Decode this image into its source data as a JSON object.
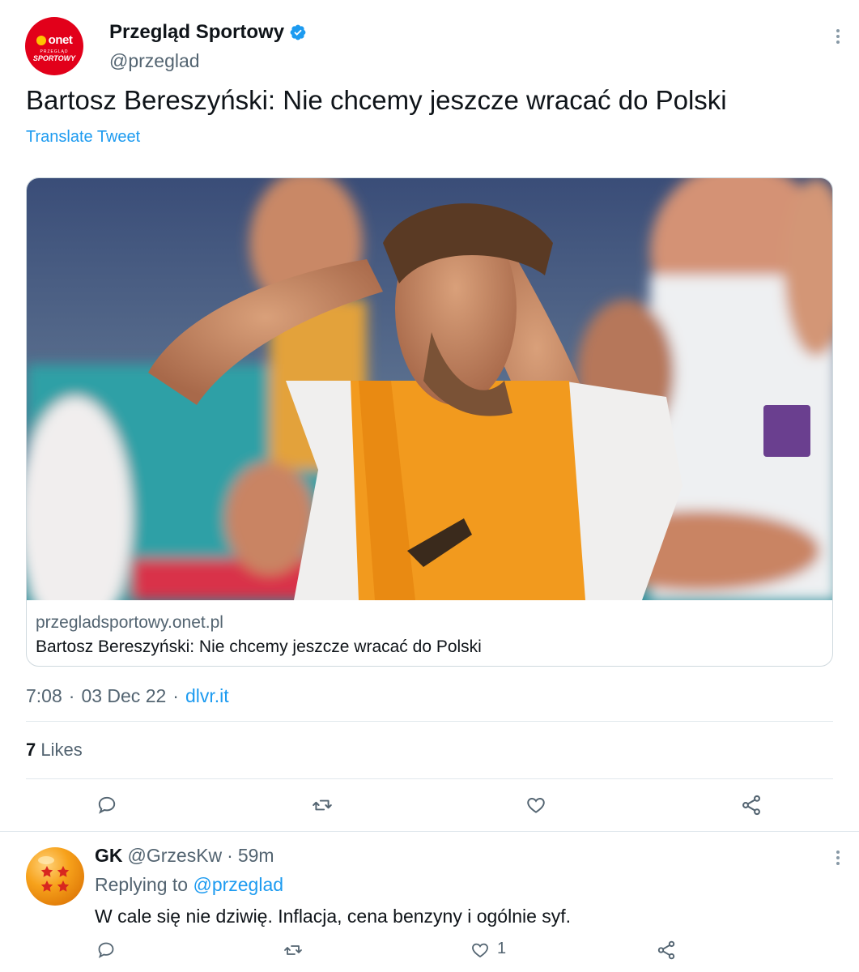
{
  "tweet": {
    "author": {
      "name": "Przegląd Sportowy",
      "handle": "@przeglad",
      "avatar_text": "onet",
      "avatar_sub1": "PRZEGLĄD",
      "avatar_sub2": "SPORTOWY",
      "verified": true
    },
    "text": "Bartosz Bereszyński: Nie chcemy jeszcze wracać do Polski",
    "translate_label": "Translate Tweet",
    "card": {
      "domain": "przegladsportowy.onet.pl",
      "title": "Bartosz Bereszyński: Nie chcemy jeszcze wracać do Polski"
    },
    "time": "7:08",
    "date": "03 Dec 22",
    "via": "dlvr.it",
    "likes_count": "7",
    "likes_label": "Likes",
    "separator": "·"
  },
  "reply": {
    "name": "GK",
    "handle": "@GrzesKw",
    "separator": "·",
    "time": "59m",
    "replying_label": "Replying to",
    "replying_to": "@przeglad",
    "text": "W cale się nie dziwię. Inflacja, cena benzyny i ogólnie syf.",
    "like_count": "1"
  },
  "colors": {
    "accent": "#1d9bf0",
    "secondary_text": "#536471",
    "brand_red": "#e2001a"
  },
  "icons": [
    "reply-icon",
    "retweet-icon",
    "like-icon",
    "share-icon",
    "more-icon",
    "verified-icon"
  ]
}
